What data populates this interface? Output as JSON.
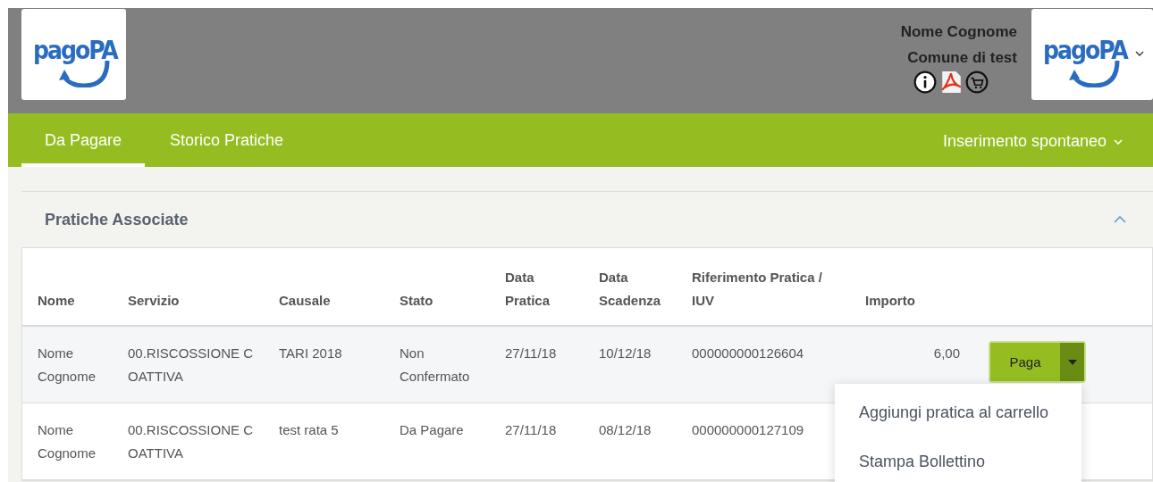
{
  "header": {
    "logo_left": "pagoPA",
    "user_name": "Nome Cognome",
    "organization": "Comune di test",
    "logo_right": "pagoPA"
  },
  "tabs": [
    {
      "label": "Da Pagare",
      "selected": true
    },
    {
      "label": "Storico Pratiche",
      "selected": false
    }
  ],
  "spontaneous_menu": {
    "label": "Inserimento spontaneo"
  },
  "panel": {
    "title": "Pratiche Associate",
    "expanded": true,
    "table": {
      "columns": [
        "Nome",
        "Servizio",
        "Causale",
        "Stato",
        "Data\nPratica",
        "Data\nScadenza",
        "Riferimento Pratica /\nIUV",
        "Importo"
      ],
      "rows": [
        {
          "cells": [
            "Nome\nCognome",
            "00.RISCOSSIONE C\nOATTIVA",
            "TARI 2018",
            "Non\nConfermato",
            "27/11/18",
            "10/12/18",
            "000000000126604",
            "6,00"
          ],
          "button": "Paga",
          "highlighted": true
        },
        {
          "cells": [
            "Nome\nCognome",
            "00.RISCOSSIONE C\nOATTIVA",
            "test rata 5",
            "Da Pagare",
            "27/11/18",
            "08/12/18",
            "000000000127109"
          ],
          "highlighted": false
        }
      ]
    }
  },
  "dropdown_menu": {
    "items": [
      "Aggiungi pratica al carrello",
      "Stampa Bollettino"
    ]
  }
}
